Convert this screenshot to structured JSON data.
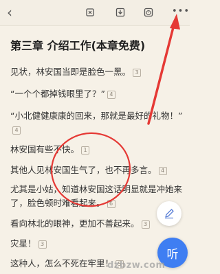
{
  "toolbar": {
    "back_icon": "chevron-left-icon",
    "icons": [
      "crop-icon",
      "download-icon",
      "timer-icon",
      "more-icon"
    ],
    "more_label": "•••"
  },
  "chapter": {
    "title": "第三章 介绍工作(本章免费)"
  },
  "paragraphs": [
    {
      "text": "见状，林安国当即是脸色一黑。",
      "note": "3"
    },
    {
      "text": "“一个个都掉钱眼里了？”",
      "note": "4"
    },
    {
      "text": "“小北健健康康的回来，那就是最好的礼物！”",
      "note": "4"
    },
    {
      "text": "林安国有些不快。",
      "note": "1"
    },
    {
      "text": "其他人见林安国生气了，也不再多言。",
      "note": "4"
    },
    {
      "text": "尤其是小姑，知道林安国这话明显就是冲她来了，脸色顿时难看起来。",
      "note": "6"
    },
    {
      "text": "看向林北的眼神，更加不善起来。",
      "note": "3"
    },
    {
      "text": "灾星！",
      "note": "3"
    },
    {
      "text": "这种人，怎么不死在牢里！",
      "note": "5"
    }
  ],
  "fab": {
    "edit_icon": "pen-icon",
    "listen_label": "听"
  },
  "annotation": {
    "circle_color": "#e53935",
    "arrow_color": "#e53935"
  },
  "watermark": "dzbzw.com",
  "colors": {
    "background": "#f6f1e7",
    "accent": "#3f7ef2"
  }
}
